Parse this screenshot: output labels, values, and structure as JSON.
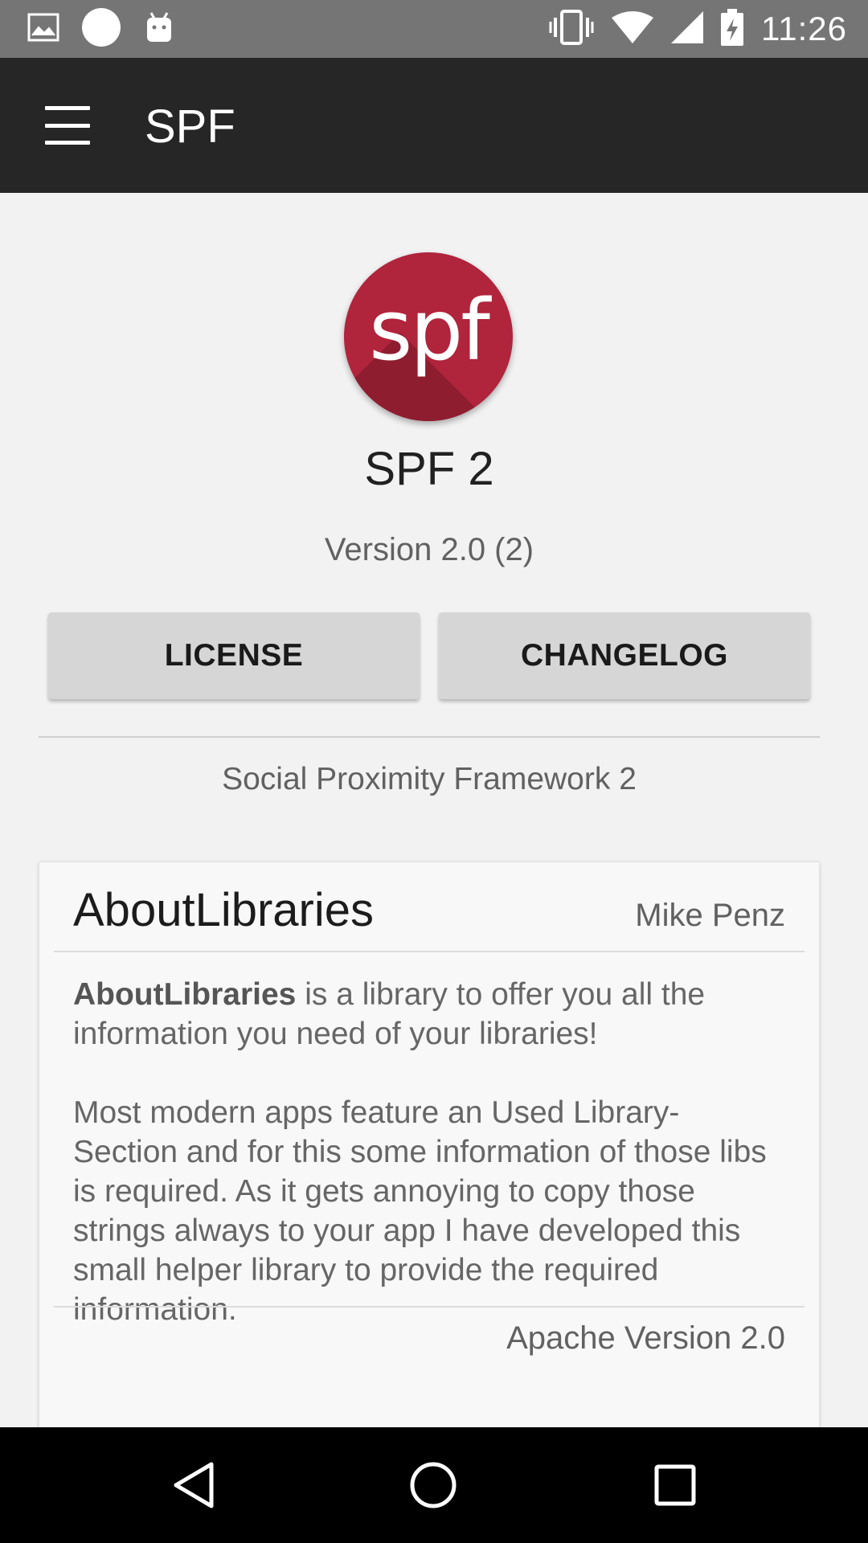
{
  "status_bar": {
    "time": "11:26",
    "left_icons": [
      "image-icon",
      "circle-icon",
      "android-icon"
    ],
    "right_icons": [
      "vibrate-icon",
      "wifi-icon",
      "signal-icon",
      "battery-charging-icon"
    ]
  },
  "app_bar": {
    "title": "SPF",
    "menu_icon": "hamburger-menu-icon",
    "background": "#262626"
  },
  "about": {
    "logo_text": "spf",
    "logo_color": "#b0243c",
    "app_name": "SPF 2",
    "version": "Version 2.0 (2)",
    "license_button": "LICENSE",
    "changelog_button": "CHANGELOG",
    "description": "Social Proximity Framework 2"
  },
  "library_card": {
    "name": "AboutLibraries",
    "author": "Mike Penz",
    "body_bold": "AboutLibraries",
    "body_p1_rest": " is a library to offer you all the information you need of your libraries!",
    "body_p2": "Most modern apps feature an Used Library-Section and for this some information of those libs is required. As it gets annoying to copy those strings always to your app I have developed this small helper library to provide the required information.",
    "license": "Apache Version 2.0"
  },
  "nav_bar": {
    "back": "back-triangle-icon",
    "home": "home-circle-icon",
    "recents": "recents-square-icon"
  }
}
